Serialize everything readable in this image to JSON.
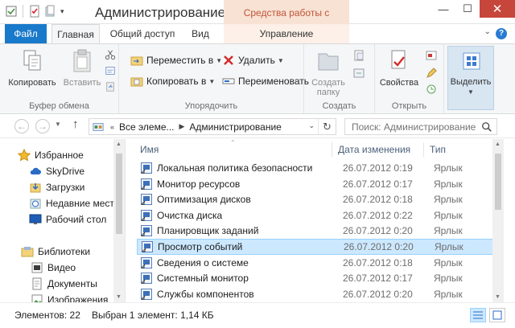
{
  "window": {
    "title": "Администрирование",
    "context_tools": "Средства работы с ярлыками"
  },
  "caption": {
    "minimize": "—",
    "maximize": "☐",
    "close": "✕"
  },
  "tabs": [
    {
      "label": "Файл"
    },
    {
      "label": "Главная"
    },
    {
      "label": "Общий доступ"
    },
    {
      "label": "Вид"
    },
    {
      "label": "Управление"
    }
  ],
  "ribbon": {
    "clipboard": {
      "label": "Буфер обмена",
      "copy": "Копировать",
      "paste": "Вставить"
    },
    "organize": {
      "label": "Упорядочить",
      "move_to": "Переместить в",
      "copy_to": "Копировать в",
      "delete": "Удалить",
      "rename": "Переименовать"
    },
    "create": {
      "label": "Создать",
      "new_folder_line1": "Создать",
      "new_folder_line2": "папку"
    },
    "open": {
      "label": "Открыть",
      "properties": "Свойства"
    },
    "select": {
      "label": "Выделить"
    }
  },
  "address": {
    "crumbs": [
      "Все элеме...",
      "Администрирование"
    ],
    "search_placeholder": "Поиск: Администрирование"
  },
  "nav": {
    "items": [
      {
        "label": "Избранное",
        "icon": "star-icon"
      },
      {
        "label": "SkyDrive",
        "icon": "cloud-icon"
      },
      {
        "label": "Загрузки",
        "icon": "downloads-icon"
      },
      {
        "label": "Недавние места",
        "icon": "recent-icon"
      },
      {
        "label": "Рабочий стол",
        "icon": "desktop-icon"
      },
      {
        "label": "Библиотеки",
        "icon": "library-icon"
      },
      {
        "label": "Видео",
        "icon": "video-icon"
      },
      {
        "label": "Документы",
        "icon": "documents-icon"
      },
      {
        "label": "Изображения",
        "icon": "images-icon"
      }
    ]
  },
  "list": {
    "columns": {
      "name": "Имя",
      "date": "Дата изменения",
      "type": "Тип"
    },
    "rows": [
      {
        "name": "Локальная политика безопасности",
        "date": "26.07.2012 0:19",
        "type": "Ярлык"
      },
      {
        "name": "Монитор ресурсов",
        "date": "26.07.2012 0:17",
        "type": "Ярлык"
      },
      {
        "name": "Оптимизация дисков",
        "date": "26.07.2012 0:18",
        "type": "Ярлык"
      },
      {
        "name": "Очистка диска",
        "date": "26.07.2012 0:22",
        "type": "Ярлык"
      },
      {
        "name": "Планировщик заданий",
        "date": "26.07.2012 0:20",
        "type": "Ярлык"
      },
      {
        "name": "Просмотр событий",
        "date": "26.07.2012 0:20",
        "type": "Ярлык"
      },
      {
        "name": "Сведения о системе",
        "date": "26.07.2012 0:18",
        "type": "Ярлык"
      },
      {
        "name": "Системный монитор",
        "date": "26.07.2012 0:17",
        "type": "Ярлык"
      },
      {
        "name": "Службы компонентов",
        "date": "26.07.2012 0:20",
        "type": "Ярлык"
      }
    ],
    "selected_index": 5
  },
  "status": {
    "count": "Элементов: 22",
    "selected": "Выбран 1 элемент: 1,14 КБ"
  },
  "colors": {
    "accent": "#1979ca",
    "selection": "#cce8ff",
    "context_tab": "#f8e2d3",
    "close": "#c7463b"
  }
}
